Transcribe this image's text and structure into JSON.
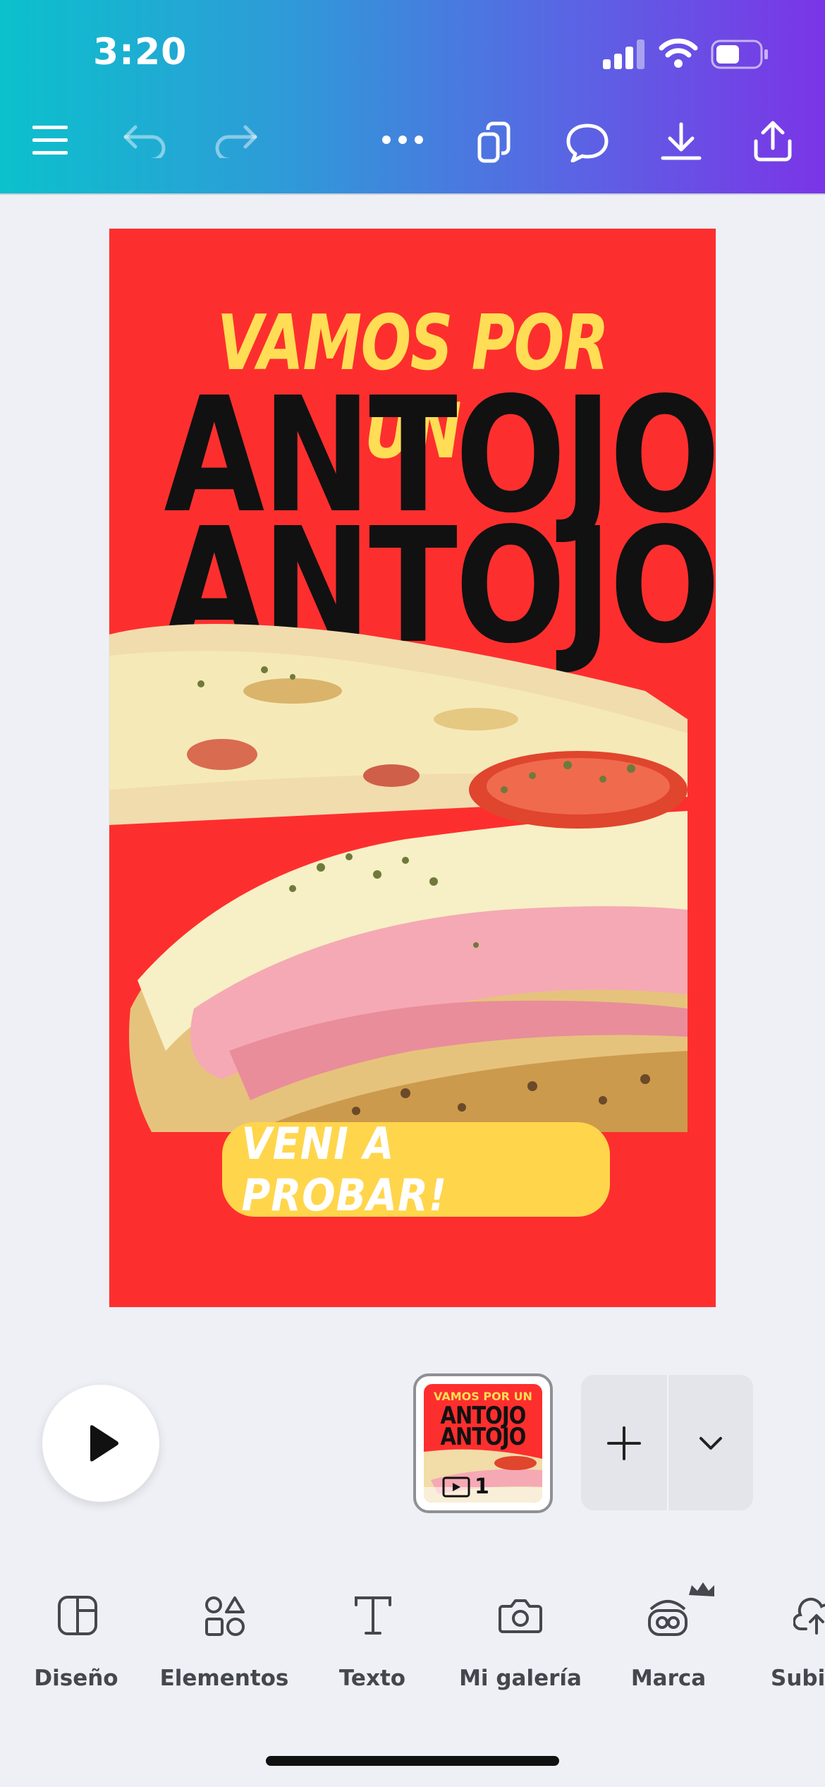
{
  "status_bar": {
    "time": "3:20"
  },
  "design": {
    "headline_small": "VAMOS POR UN",
    "headline_line1": "ANTOJO",
    "headline_line2": "ANTOJO",
    "cta_label": "VENI A PROBAR!"
  },
  "pages": {
    "thumbnail_title_small": "VAMOS POR UN",
    "thumbnail_line1": "ANTOJO",
    "thumbnail_line2": "ANTOJO",
    "thumbnail_count": "1"
  },
  "tabs": [
    {
      "label": "Diseño",
      "icon": "layout-icon"
    },
    {
      "label": "Elementos",
      "icon": "shapes-icon"
    },
    {
      "label": "Texto",
      "icon": "text-icon"
    },
    {
      "label": "Mi galería",
      "icon": "camera-icon"
    },
    {
      "label": "Marca",
      "icon": "brand-icon"
    },
    {
      "label": "Subir",
      "icon": "upload-cloud-icon"
    }
  ],
  "colors": {
    "design_bg": "#fd2f2e",
    "accent_yellow": "#ffd54b",
    "header_start": "#0bc1cc",
    "header_end": "#7b35e6"
  }
}
